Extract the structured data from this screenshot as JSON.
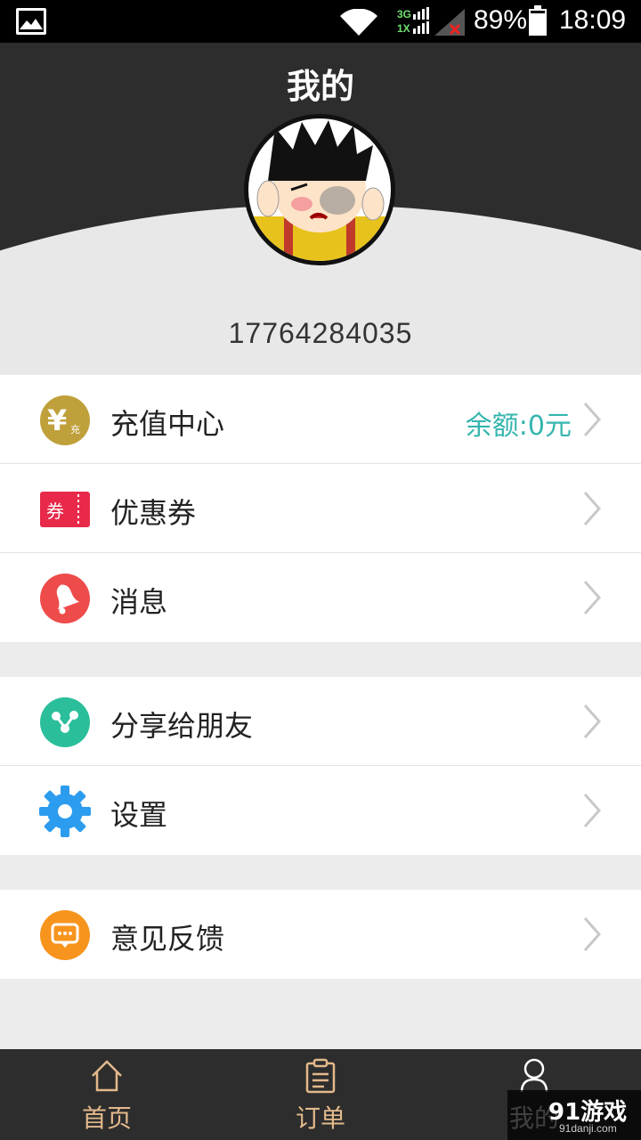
{
  "status_bar": {
    "network": "3G",
    "network2": "1X",
    "battery": "89%",
    "battery_level": 0.89,
    "time": "18:09"
  },
  "header": {
    "title": "我的",
    "phone": "17764284035"
  },
  "menu_group_1": [
    {
      "label": "充值中心",
      "icon": "yuan-coin-icon",
      "extra": "余额:0元",
      "color": "#bfa03a"
    },
    {
      "label": "优惠券",
      "icon": "coupon-icon",
      "color": "#e8294a"
    },
    {
      "label": "消息",
      "icon": "bell-icon",
      "color": "#ee4b4b"
    }
  ],
  "menu_group_2": [
    {
      "label": "分享给朋友",
      "icon": "share-icon",
      "color": "#2abf9a"
    },
    {
      "label": "设置",
      "icon": "gear-icon",
      "color": "#2c9cef"
    }
  ],
  "menu_group_3": [
    {
      "label": "意见反馈",
      "icon": "feedback-icon",
      "color": "#f7941d"
    }
  ],
  "icon_text": {
    "coin_small": "充",
    "coupon": "券"
  },
  "tabs": [
    {
      "label": "首页",
      "icon": "home-icon"
    },
    {
      "label": "订单",
      "icon": "clipboard-icon"
    },
    {
      "label": "我的",
      "icon": "user-icon"
    }
  ],
  "watermark": {
    "brand": "91游戏",
    "site": "91danji.com"
  },
  "colors": {
    "accent": "#35b5ae",
    "tab_text": "#e3b98c",
    "header_bg": "#2d2d2d"
  }
}
